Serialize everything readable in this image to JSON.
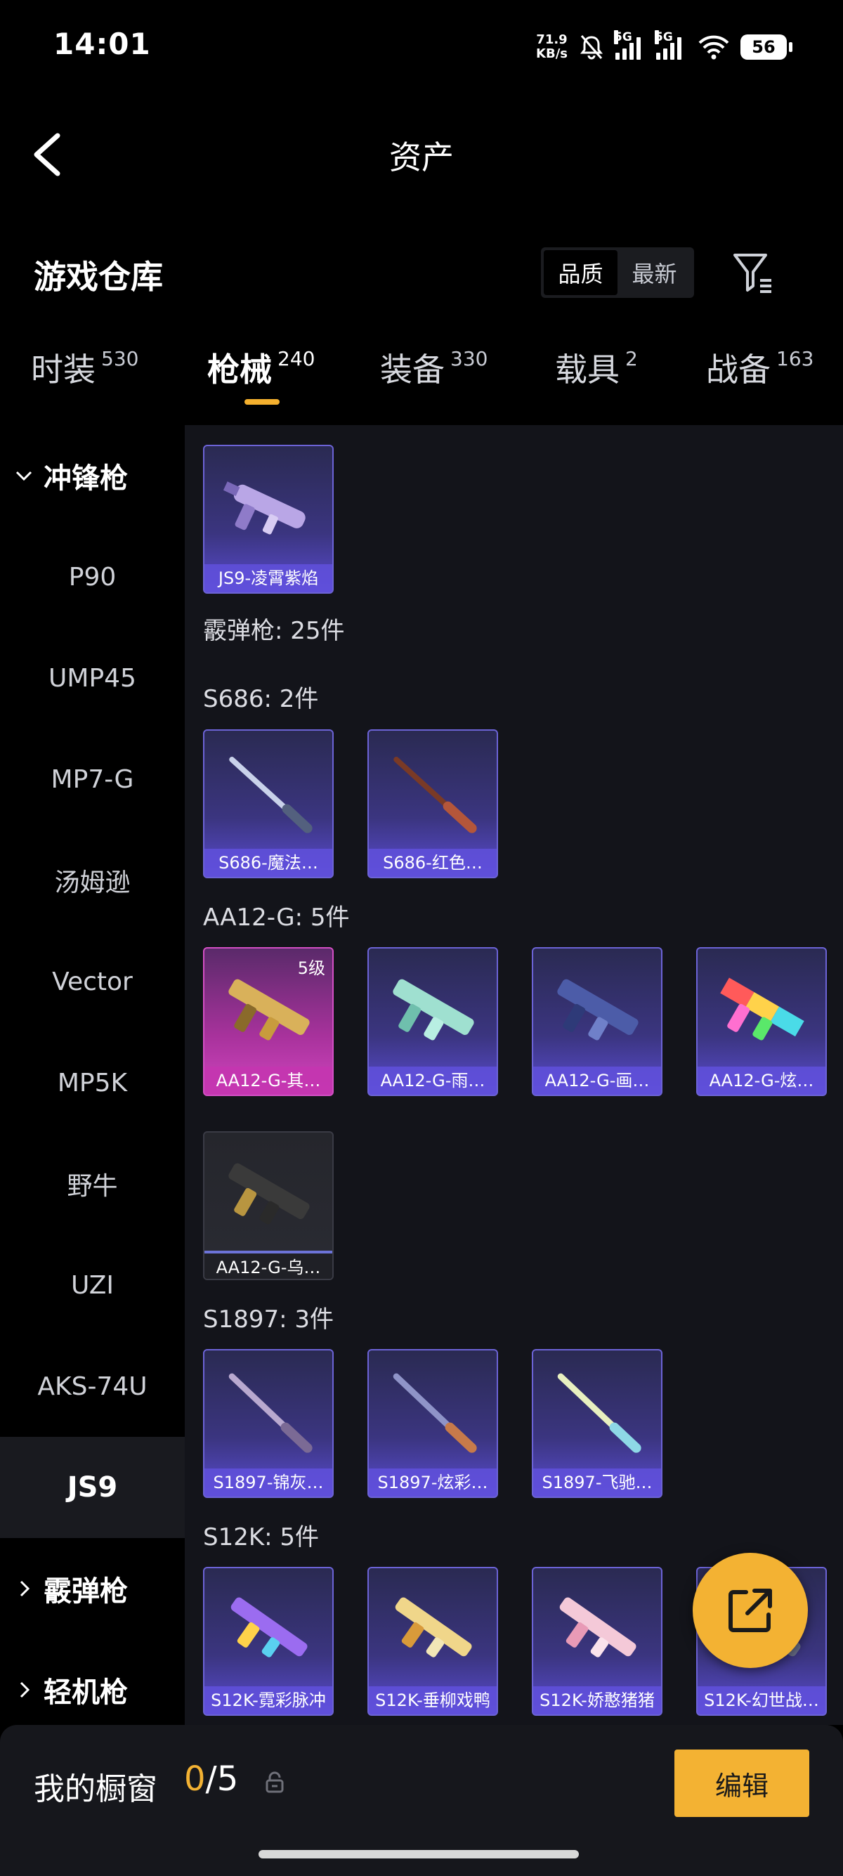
{
  "status_bar": {
    "time": "14:01",
    "net_speed_value": "71.9",
    "net_speed_unit": "KB/s",
    "signal_1": "5G",
    "signal_2": "5G",
    "battery": "56"
  },
  "header": {
    "title": "资产"
  },
  "warehouse": {
    "title": "游戏仓库",
    "sort_options": [
      "品质",
      "最新"
    ],
    "active_sort": "品质"
  },
  "tabs": [
    {
      "label": "时装",
      "count": "530"
    },
    {
      "label": "枪械",
      "count": "240"
    },
    {
      "label": "装备",
      "count": "330"
    },
    {
      "label": "载具",
      "count": "2"
    },
    {
      "label": "战备",
      "count": "163"
    }
  ],
  "active_tab": "枪械",
  "sidebar": {
    "group_expanded": "冲锋枪",
    "items": [
      "P90",
      "UMP45",
      "MP7-G",
      "汤姆逊",
      "Vector",
      "MP5K",
      "野牛",
      "UZI",
      "AKS-74U",
      "JS9"
    ],
    "selected": "JS9",
    "group_collapsed_1": "霰弹枪",
    "group_collapsed_2": "轻机枪"
  },
  "content": {
    "top_item": "JS9-凌霄紫焰",
    "category_summary": "霰弹枪: 25件",
    "groups": [
      {
        "label": "S686: 2件",
        "items": [
          "S686-魔法…",
          "S686-红色…"
        ]
      },
      {
        "label": "AA12-G: 5件",
        "items": [
          "AA12-G-其…",
          "AA12-G-雨…",
          "AA12-G-画…",
          "AA12-G-炫…",
          "AA12-G-乌…"
        ],
        "first_level": "5级"
      },
      {
        "label": "S1897: 3件",
        "items": [
          "S1897-锦灰…",
          "S1897-炫彩…",
          "S1897-飞驰…"
        ]
      },
      {
        "label": "S12K: 5件",
        "items": [
          "S12K-霓彩脉冲",
          "S12K-垂柳戏鸭",
          "S12K-娇憨猪猪",
          "S12K-幻世战…"
        ]
      }
    ]
  },
  "bottom": {
    "showcase_label": "我的橱窗",
    "showcase_used": "0",
    "showcase_sep": "/",
    "showcase_total": "5",
    "edit_label": "编辑"
  },
  "colors": {
    "accent": "#f3b233",
    "card_purple": "#5a4cd2",
    "card_pink": "#d045be",
    "background": "#000000",
    "content_bg": "#13141a"
  }
}
